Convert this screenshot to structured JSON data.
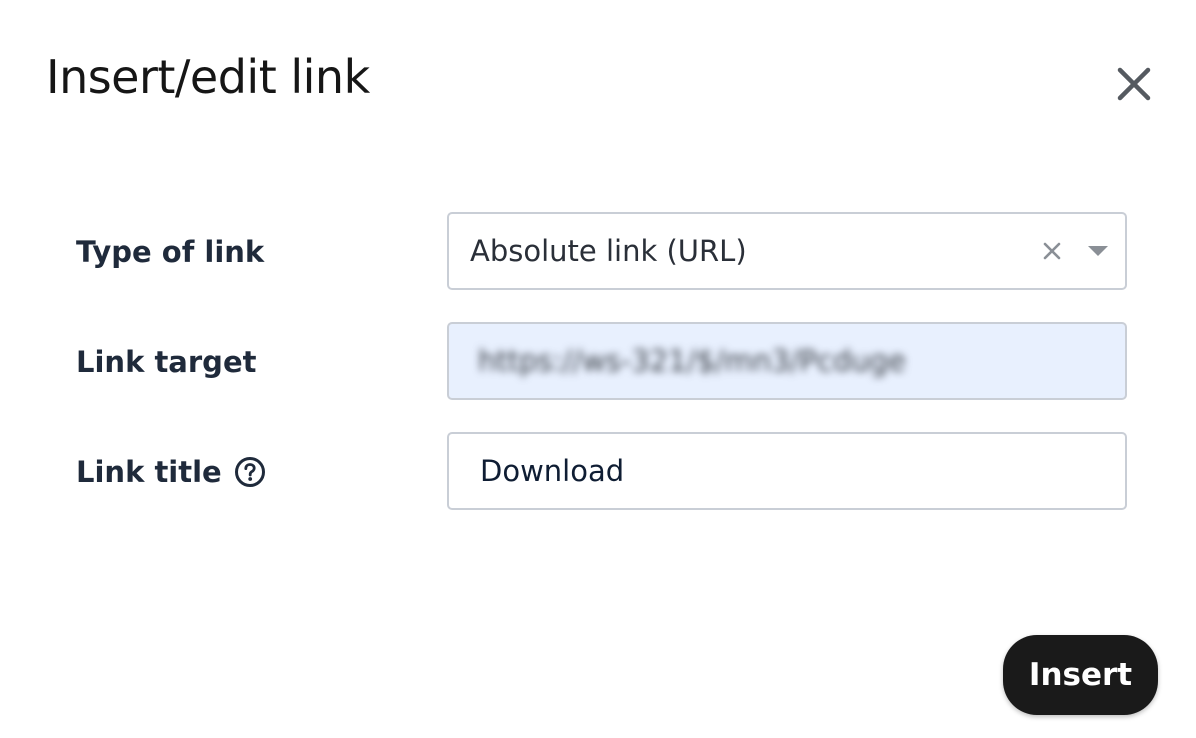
{
  "dialog": {
    "title": "Insert/edit link",
    "close_icon": "close-icon"
  },
  "form": {
    "link_type": {
      "label": "Type of link",
      "value": "Absolute link (URL)",
      "clear_icon": "clear-icon",
      "dropdown_icon": "chevron-down-icon"
    },
    "link_target": {
      "label": "Link target",
      "value": "https://ws-321/$/mn3/Pcduge",
      "autofill_background": "#e8f0fe"
    },
    "link_title": {
      "label": "Link title",
      "help_icon": "question-circle-icon",
      "value": "Download"
    }
  },
  "actions": {
    "insert_label": "Insert"
  },
  "colors": {
    "primary_button": "#1a1a1a",
    "field_border": "#c9ced6",
    "label_text": "#1f2a3b"
  }
}
